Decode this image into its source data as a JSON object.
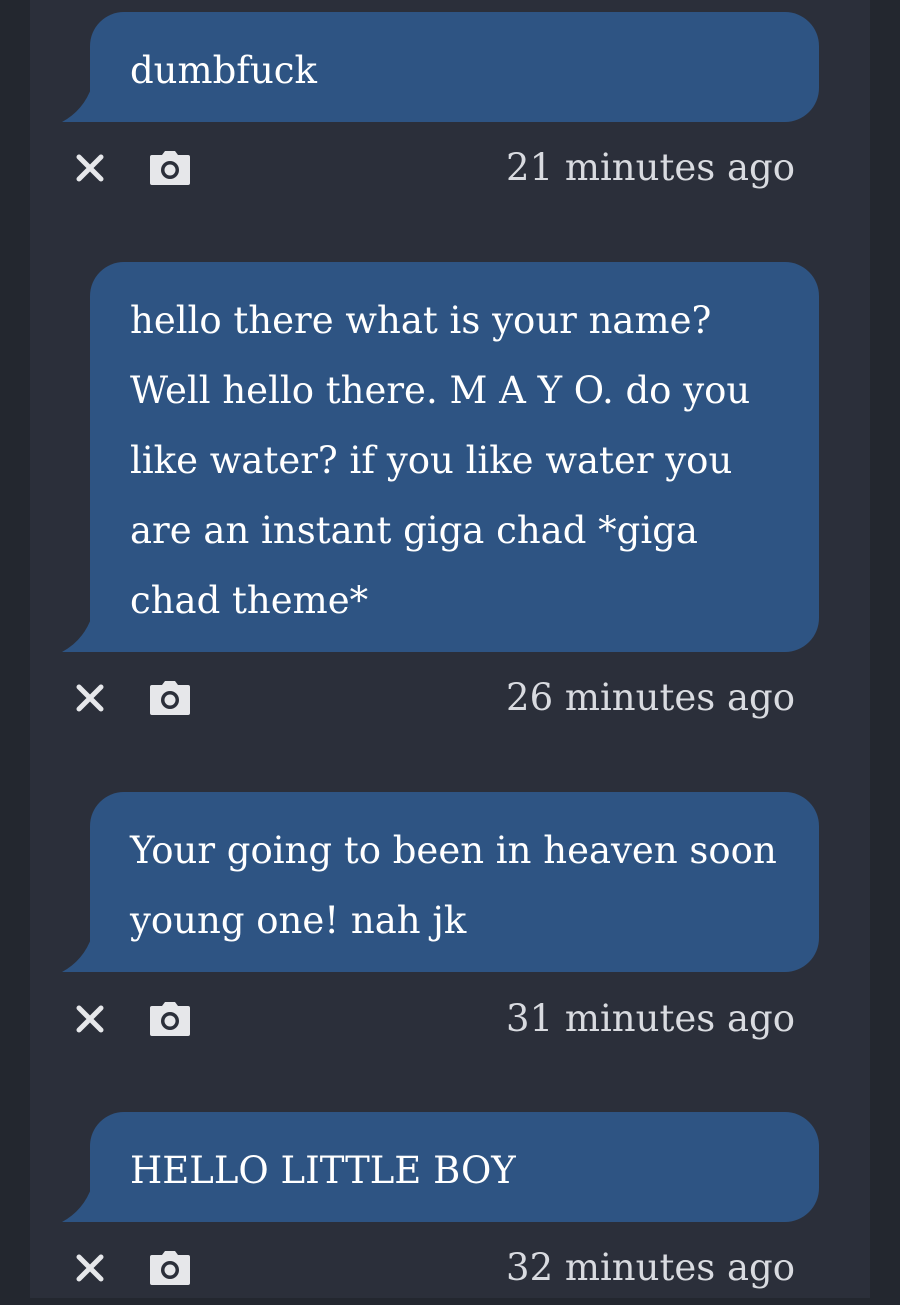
{
  "messages": [
    {
      "text": "dumbfuck",
      "timestamp": "21 minutes ago",
      "icons": {
        "delete": "close-icon",
        "screenshot": "camera-icon"
      }
    },
    {
      "text": "hello there what is your name? Well hello there. M A Y O. do you like water? if you like water you are an instant giga chad *giga chad theme*",
      "timestamp": "26 minutes ago",
      "icons": {
        "delete": "close-icon",
        "screenshot": "camera-icon"
      }
    },
    {
      "text": "Your going to been in heaven soon young one! nah jk",
      "timestamp": "31 minutes ago",
      "icons": {
        "delete": "close-icon",
        "screenshot": "camera-icon"
      }
    },
    {
      "text": "HELLO LITTLE BOY",
      "timestamp": "32 minutes ago",
      "icons": {
        "delete": "close-icon",
        "screenshot": "camera-icon"
      }
    }
  ],
  "colors": {
    "page_background": "#23272f",
    "panel_background": "#2b2f3a",
    "bubble": "#2e5483",
    "text": "#ffffff",
    "meta_text": "#d9dbe0"
  }
}
